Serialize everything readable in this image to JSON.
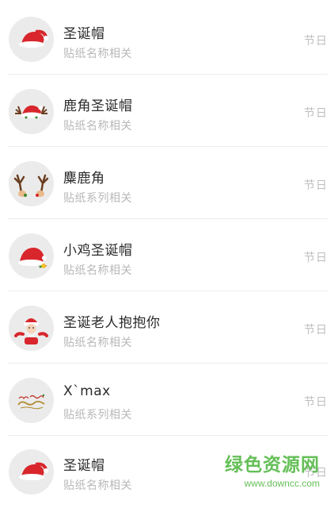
{
  "stickers": [
    {
      "title": "圣诞帽",
      "subtitle": "贴纸名称相关",
      "tag": "节日",
      "icon": "santa-hat-icon"
    },
    {
      "title": "鹿角圣诞帽",
      "subtitle": "贴纸名称相关",
      "tag": "节日",
      "icon": "antler-santa-hat-icon"
    },
    {
      "title": "麋鹿角",
      "subtitle": "贴纸系列相关",
      "tag": "节日",
      "icon": "reindeer-antlers-icon"
    },
    {
      "title": "小鸡圣诞帽",
      "subtitle": "贴纸名称相关",
      "tag": "节日",
      "icon": "chick-santa-hat-icon"
    },
    {
      "title": "圣诞老人抱抱你",
      "subtitle": "贴纸名称相关",
      "tag": "节日",
      "icon": "santa-hug-icon"
    },
    {
      "title": "X`max",
      "subtitle": "贴纸系列相关",
      "tag": "节日",
      "icon": "merry-christmas-text-icon"
    },
    {
      "title": "圣诞帽",
      "subtitle": "贴纸名称相关",
      "tag": "节日",
      "icon": "santa-hat-icon"
    }
  ],
  "watermark": {
    "name": "绿色资源网",
    "url": "www.downcc.com"
  },
  "colors": {
    "title": "#2b2b2b",
    "subtitle": "#b8b8b8",
    "avatar_bg": "#ebebeb",
    "watermark": "#4ab43a"
  }
}
